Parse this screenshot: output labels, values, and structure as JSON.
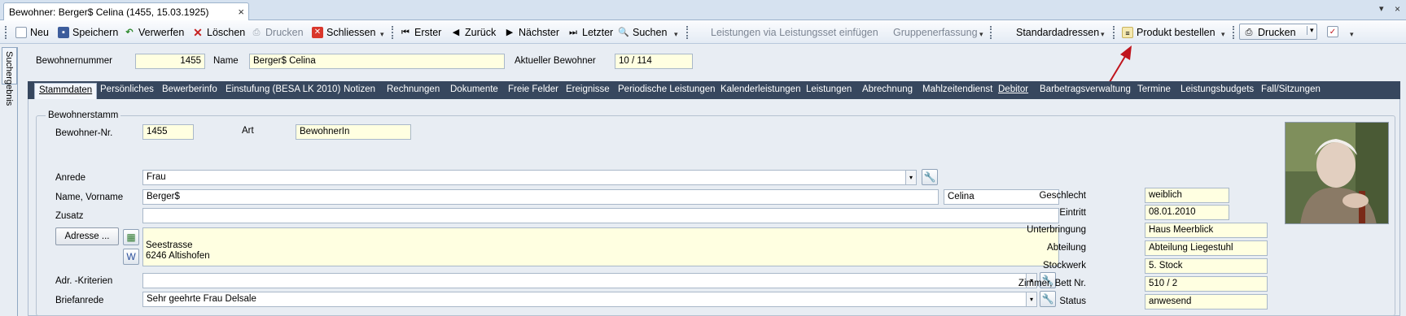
{
  "document_tab": {
    "title": "Bewohner: Berger$ Celina (1455, 15.03.1925)",
    "close": "×"
  },
  "tabstrip_controls": {
    "dropdown": "▾",
    "close": "×"
  },
  "toolbar": {
    "neu": "Neu",
    "speichern": "Speichern",
    "verwerfen": "Verwerfen",
    "loeschen": "Löschen",
    "drucken_disabled": "Drucken",
    "schliessen": "Schliessen",
    "erster": "Erster",
    "zurueck": "Zurück",
    "naechster": "Nächster",
    "letzter": "Letzter",
    "suchen": "Suchen",
    "leistungen_set": "Leistungen via Leistungsset einfügen",
    "gruppenerfassung": "Gruppenerfassung",
    "standardadressen": "Standardadressen",
    "produkt_bestellen": "Produkt bestellen",
    "drucken": "Drucken"
  },
  "side_tab": {
    "label": "Suchergebnis"
  },
  "header": {
    "bewohnernummer_label": "Bewohnernummer",
    "bewohnernummer_value": "1455",
    "name_label": "Name",
    "name_value": "Berger$ Celina",
    "aktueller_label": "Aktueller Bewohner",
    "aktueller_value": "10 / 114"
  },
  "nav_tabs": [
    "Stammdaten",
    "Persönliches",
    "Bewerberinfo",
    "Einstufung (BESA LK 2010)",
    "Notizen",
    "Rechnungen",
    "Dokumente",
    "Freie Felder",
    "Ereignisse",
    "Periodische Leistungen",
    "Kalenderleistungen",
    "Leistungen",
    "Abrechnung",
    "Mahlzeitendienst",
    "Debitor",
    "Barbetragsverwaltung",
    "Termine",
    "Leistungsbudgets",
    "Fall/Sitzungen"
  ],
  "form": {
    "group_title": "Bewohnerstamm",
    "bewohner_nr_label": "Bewohner-Nr.",
    "bewohner_nr_value": "1455",
    "art_label": "Art",
    "art_value": "BewohnerIn",
    "anrede_label": "Anrede",
    "anrede_value": "Frau",
    "name_vorname_label": "Name, Vorname",
    "name_value": "Berger$",
    "vorname_value": "Celina",
    "zusatz_label": "Zusatz",
    "zusatz_value": "",
    "adresse_button": "Adresse ...",
    "adresse_line1": "Seestrasse",
    "adresse_line2": "6246 Altishofen",
    "adr_kriterien_label": "Adr. -Kriterien",
    "adr_kriterien_value": "",
    "briefanrede_label": "Briefanrede",
    "briefanrede_value": "Sehr geehrte Frau Delsale"
  },
  "details": {
    "geschlecht_label": "Geschlecht",
    "geschlecht_value": "weiblich",
    "eintritt_label": "Eintritt",
    "eintritt_value": "08.01.2010",
    "unterbringung_label": "Unterbringung",
    "unterbringung_value": "Haus Meerblick",
    "abteilung_label": "Abteilung",
    "abteilung_value": "Abteilung Liegestuhl",
    "stockwerk_label": "Stockwerk",
    "stockwerk_value": "5. Stock",
    "zimmer_label": "Zimmer, Bett Nr.",
    "zimmer_value": "510 / 2",
    "status_label": "Status",
    "status_value": "anwesend"
  },
  "colors": {
    "accent": "#37475e",
    "field": "#ffffe1",
    "arrow": "#c0141c"
  }
}
